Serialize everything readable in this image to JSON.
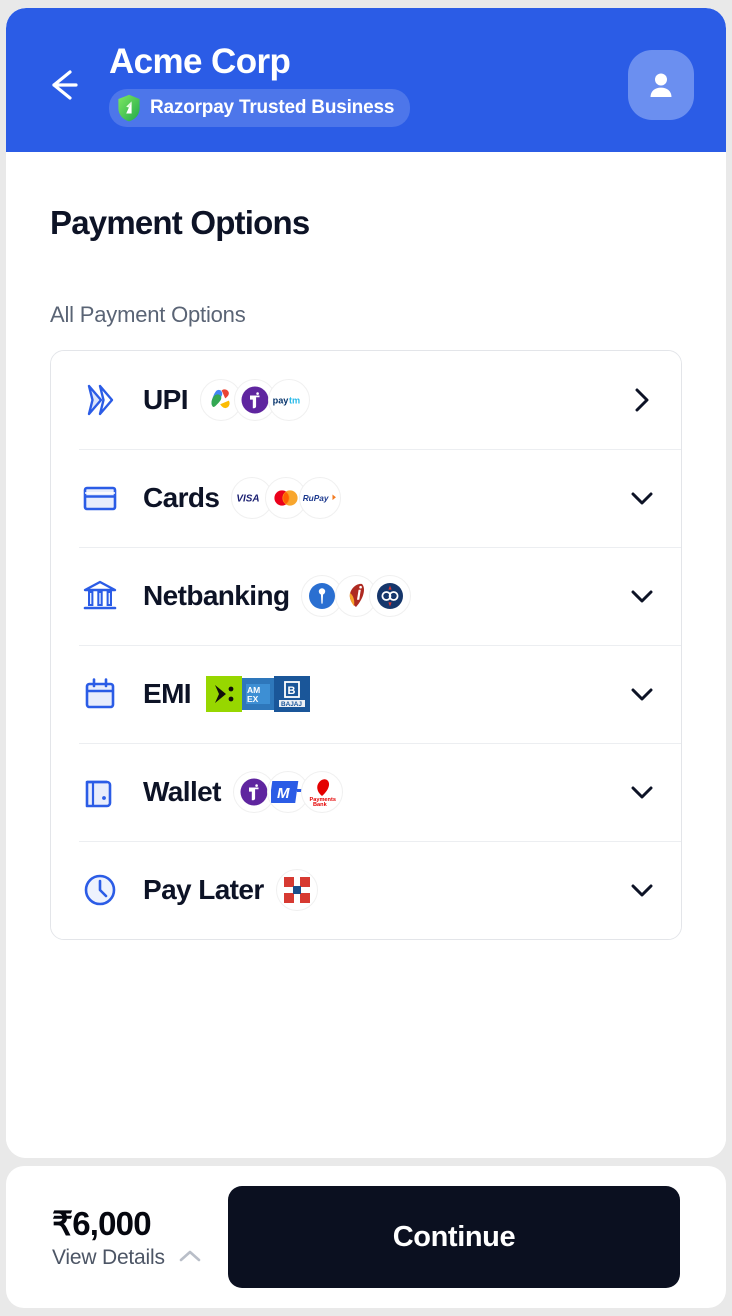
{
  "theme": {
    "header_blue": "#2b5ce6",
    "avatar_blue": "#6b8ff0",
    "accent_icon_blue": "#2b5ce6",
    "dark_button": "#0b1020",
    "page_bg": "#e9e9e9",
    "text_dark": "#0d1326",
    "text_muted": "#5a6475"
  },
  "header": {
    "back_icon": "arrow-left-icon",
    "merchant_name": "Acme Corp",
    "trust_badge_text": "Razorpay Trusted Business",
    "trust_badge_icon": "shield-icon",
    "avatar_icon": "user-icon"
  },
  "main": {
    "page_title": "Payment Options",
    "section_label": "All Payment Options",
    "options": [
      {
        "id": "upi",
        "label": "UPI",
        "icon": "upi-arrows-icon",
        "chevron": "chevron-right-icon",
        "brands": [
          "Google Pay",
          "PhonePe",
          "Paytm"
        ]
      },
      {
        "id": "cards",
        "label": "Cards",
        "icon": "credit-card-icon",
        "chevron": "chevron-down-icon",
        "brands": [
          "VISA",
          "Mastercard",
          "RuPay"
        ]
      },
      {
        "id": "netbanking",
        "label": "Netbanking",
        "icon": "bank-icon",
        "chevron": "chevron-down-icon",
        "brands": [
          "SBI",
          "ICICI Bank",
          "Bank of Baroda"
        ]
      },
      {
        "id": "emi",
        "label": "EMI",
        "icon": "calendar-icon",
        "chevron": "chevron-down-icon",
        "brands": [
          "Axis Bank",
          "American Express",
          "Bajaj Finserv"
        ]
      },
      {
        "id": "wallet",
        "label": "Wallet",
        "icon": "wallet-icon",
        "chevron": "chevron-down-icon",
        "brands": [
          "PhonePe",
          "MobiKwik",
          "Airtel Payments Bank"
        ]
      },
      {
        "id": "paylater",
        "label": "Pay Later",
        "icon": "clock-icon",
        "chevron": "chevron-down-icon",
        "brands": [
          "Kotak"
        ]
      }
    ]
  },
  "footer": {
    "amount": "₹6,000",
    "view_details_label": "View Details",
    "view_details_icon": "chevron-up-icon",
    "continue_label": "Continue"
  }
}
